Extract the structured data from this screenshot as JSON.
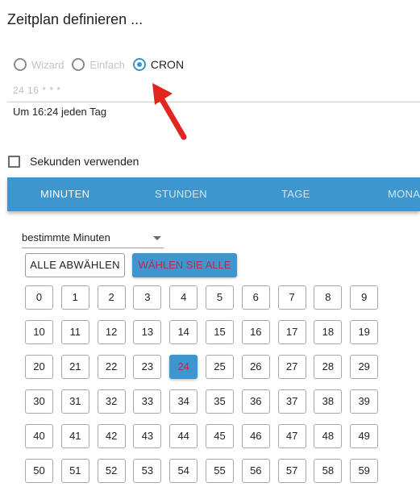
{
  "title": "Zeitplan definieren ...",
  "mode_options": [
    {
      "label": "Wizard",
      "checked": false
    },
    {
      "label": "Einfach",
      "checked": false
    },
    {
      "label": "CRON",
      "checked": true
    }
  ],
  "cron": {
    "value": "24 16 * * *",
    "description": "Um 16:24 jeden Tag"
  },
  "seconds_checkbox": {
    "label": "Sekunden verwenden",
    "checked": false
  },
  "tabs": [
    {
      "label": "MINUTEN",
      "active": true
    },
    {
      "label": "STUNDEN",
      "active": false
    },
    {
      "label": "TAGE",
      "active": false
    },
    {
      "label": "MONA",
      "active": false
    }
  ],
  "minute_mode_select": {
    "value": "bestimmte Minuten"
  },
  "buttons": {
    "deselect_all": "ALLE ABWÄHLEN",
    "select_all": "WÄHLEN SIE ALLE"
  },
  "minutes": [
    "0",
    "1",
    "2",
    "3",
    "4",
    "5",
    "6",
    "7",
    "8",
    "9",
    "10",
    "11",
    "12",
    "13",
    "14",
    "15",
    "16",
    "17",
    "18",
    "19",
    "20",
    "21",
    "22",
    "23",
    "24",
    "25",
    "26",
    "27",
    "28",
    "29",
    "30",
    "31",
    "32",
    "33",
    "34",
    "35",
    "36",
    "37",
    "38",
    "39",
    "40",
    "41",
    "42",
    "43",
    "44",
    "45",
    "46",
    "47",
    "48",
    "49",
    "50",
    "51",
    "52",
    "53",
    "54",
    "55",
    "56",
    "57",
    "58",
    "59"
  ],
  "selected_minutes": [
    "24"
  ],
  "colors": {
    "accent": "#3d97ce",
    "selected_text": "#b52a55",
    "annotation_arrow": "#e3251f"
  }
}
